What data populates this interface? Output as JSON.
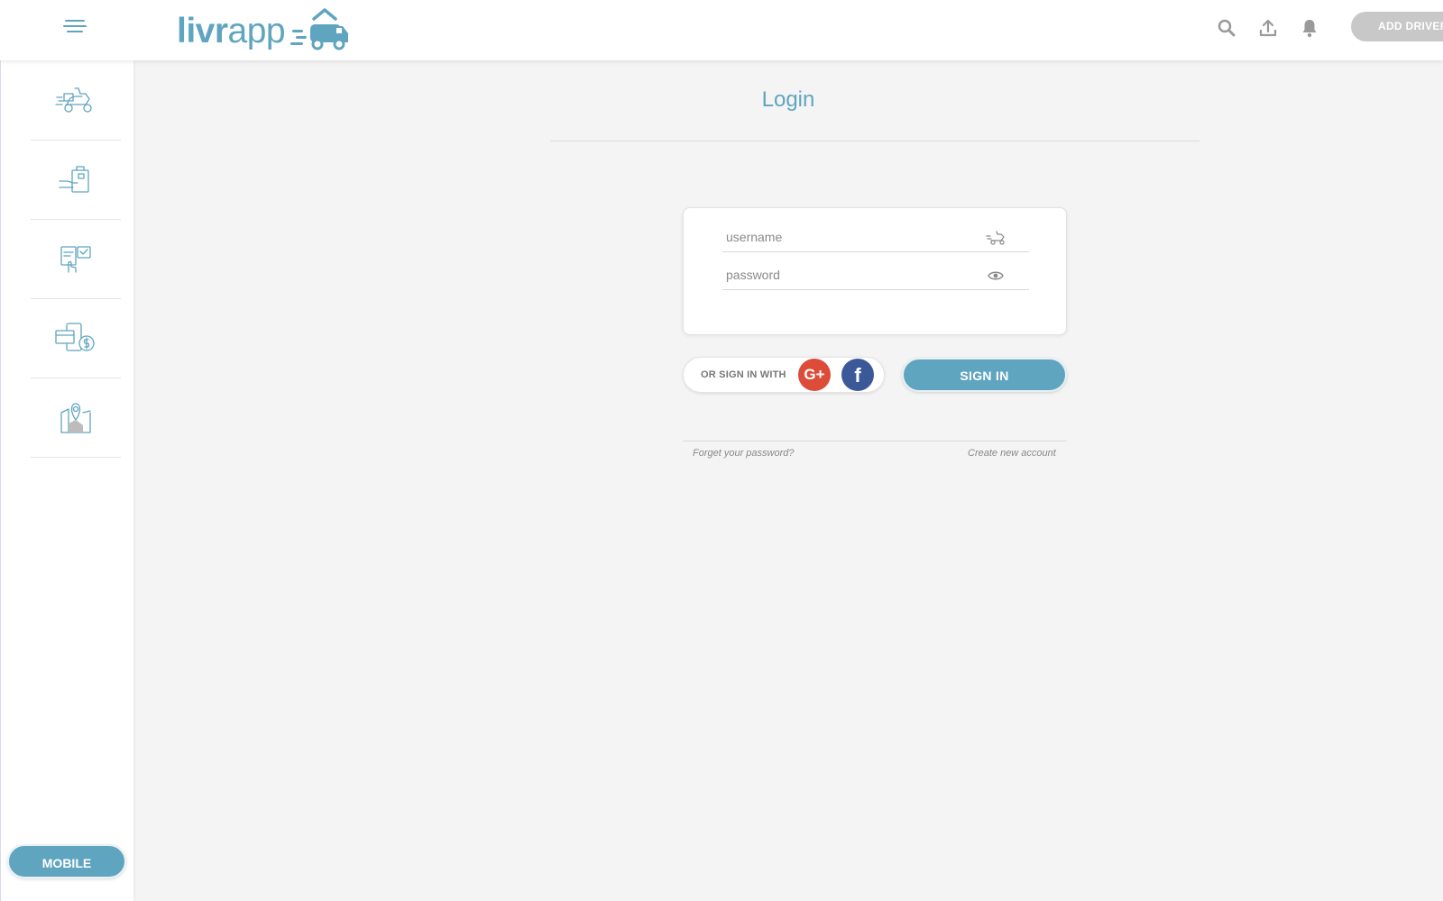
{
  "header": {
    "logo": {
      "text_bold": "livr",
      "text_light": "app"
    },
    "icons": [
      "search-icon",
      "upload-icon",
      "bell-icon"
    ],
    "add_driver_label": "ADD DRIVER"
  },
  "sidebar": {
    "items": [
      {
        "icon": "delivery-scooter-icon"
      },
      {
        "icon": "hand-bag-icon"
      },
      {
        "icon": "touch-order-icon"
      },
      {
        "icon": "payment-card-icon"
      },
      {
        "icon": "map-pin-icon"
      }
    ],
    "mobile_label": "MOBILE"
  },
  "login": {
    "title": "Login",
    "username_placeholder": "username",
    "password_placeholder": "password",
    "social_label": "OR SIGN IN WITH",
    "google_label": "G+",
    "facebook_label": "f",
    "signin_label": "SIGN IN",
    "forgot_label": "Forget your password?",
    "create_label": "Create new account"
  },
  "colors": {
    "accent": "#5fa5bf",
    "google": "#dd4b39",
    "facebook": "#3b5998",
    "background": "#f4f4f4"
  }
}
